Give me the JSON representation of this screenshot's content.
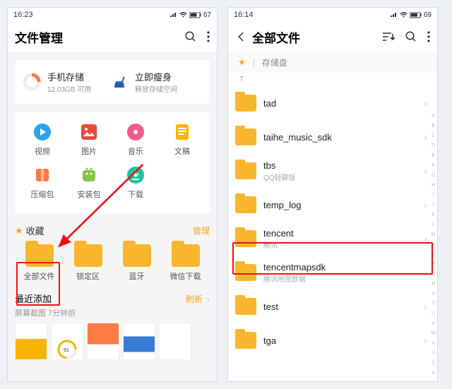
{
  "left": {
    "statusbar": {
      "time": "16:23",
      "battery": "67"
    },
    "title": "文件管理",
    "storage": {
      "phone": {
        "title": "手机存储",
        "sub": "12.03GB 可用"
      },
      "slim": {
        "title": "立即瘦身",
        "sub": "释放存储空间"
      }
    },
    "categories": [
      {
        "label": "视频",
        "name": "cat-video",
        "color": "#29a3ef",
        "glyph": "video"
      },
      {
        "label": "图片",
        "name": "cat-images",
        "color": "#e84b3c",
        "glyph": "image"
      },
      {
        "label": "音乐",
        "name": "cat-music",
        "color": "#f15b8b",
        "glyph": "music"
      },
      {
        "label": "文稿",
        "name": "cat-docs",
        "color": "#f7b500",
        "glyph": "doc"
      },
      {
        "label": "压缩包",
        "name": "cat-archives",
        "color": "#ff7a45",
        "glyph": "zip"
      },
      {
        "label": "安装包",
        "name": "cat-apk",
        "color": "#8bc34a",
        "glyph": "apk"
      },
      {
        "label": "下载",
        "name": "cat-downloads",
        "color": "#1ac1a1",
        "glyph": "dl"
      }
    ],
    "favorites": {
      "heading": "收藏",
      "manage": "管理",
      "items": [
        {
          "label": "全部文件",
          "name": "fav-all-files"
        },
        {
          "label": "锁定区",
          "name": "fav-locked"
        },
        {
          "label": "蓝牙",
          "name": "fav-bluetooth"
        },
        {
          "label": "微信下载",
          "name": "fav-wechat-dl"
        }
      ]
    },
    "recent": {
      "heading": "最近添加",
      "refresh": "刷新",
      "sub": "屏幕截图   7分钟前"
    }
  },
  "right": {
    "statusbar": {
      "time": "16:14",
      "battery": "69"
    },
    "title": "全部文件",
    "filter": {
      "storage": "存储盘"
    },
    "section": "T",
    "files": [
      {
        "name": "tad",
        "sub": ""
      },
      {
        "name": "taihe_music_sdk",
        "sub": ""
      },
      {
        "name": "tbs",
        "sub": "QQ轻聊版"
      },
      {
        "name": "temp_log",
        "sub": ""
      },
      {
        "name": "tencent",
        "sub": "腾讯"
      },
      {
        "name": "tencentmapsdk",
        "sub": "腾讯地图数据"
      },
      {
        "name": "test",
        "sub": ""
      },
      {
        "name": "tga",
        "sub": ""
      }
    ],
    "alpha": [
      "A",
      "B",
      "C",
      "D",
      "E",
      "F",
      "G",
      "H",
      "I",
      "J",
      "K",
      "L",
      "M",
      "N",
      "O",
      "P",
      "Q",
      "R",
      "S",
      "T",
      "U",
      "V",
      "W",
      "X",
      "Y",
      "Z",
      "#"
    ]
  }
}
